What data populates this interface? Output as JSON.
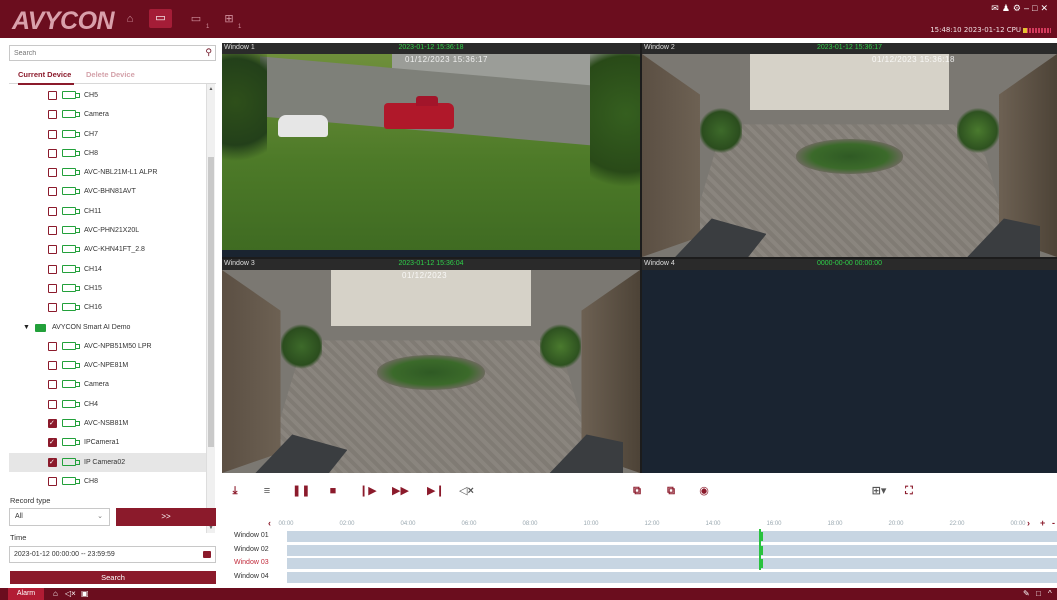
{
  "app": {
    "logo": "AVYCON"
  },
  "topbar": {
    "sub_label_1": "1",
    "sub_label_2": "1",
    "clock_text": "15:48:10 2023-01-12 CPU"
  },
  "sidebar": {
    "search_placeholder": "Search",
    "tabs": {
      "current": "Current Device",
      "delete": "Delete Device"
    },
    "tree": [
      {
        "type": "cam",
        "label": "CH5",
        "checked": false
      },
      {
        "type": "cam",
        "label": "Camera",
        "checked": false
      },
      {
        "type": "cam",
        "label": "CH7",
        "checked": false
      },
      {
        "type": "cam",
        "label": "CH8",
        "checked": false
      },
      {
        "type": "cam",
        "label": "AVC-NBL21M-L1 ALPR",
        "checked": false
      },
      {
        "type": "cam",
        "label": "AVC-BHN81AVT",
        "checked": false
      },
      {
        "type": "cam",
        "label": "CH11",
        "checked": false
      },
      {
        "type": "cam",
        "label": "AVC-PHN21X20L",
        "checked": false
      },
      {
        "type": "cam",
        "label": "AVC-KHN41FT_2.8",
        "checked": false
      },
      {
        "type": "cam",
        "label": "CH14",
        "checked": false
      },
      {
        "type": "cam",
        "label": "CH15",
        "checked": false
      },
      {
        "type": "cam",
        "label": "CH16",
        "checked": false
      },
      {
        "type": "nvr",
        "label": "AVYCON Smart AI Demo"
      },
      {
        "type": "cam",
        "label": "AVC-NPB51M50 LPR",
        "checked": false
      },
      {
        "type": "cam",
        "label": "AVC-NPE81M",
        "checked": false
      },
      {
        "type": "cam",
        "label": "Camera",
        "checked": false
      },
      {
        "type": "cam",
        "label": "CH4",
        "checked": false
      },
      {
        "type": "cam",
        "label": "AVC-NSB81M",
        "checked": true
      },
      {
        "type": "cam",
        "label": "IPCamera1",
        "checked": true
      },
      {
        "type": "cam",
        "label": "IP Camera02",
        "checked": true,
        "selected": true
      },
      {
        "type": "cam",
        "label": "CH8",
        "checked": false
      }
    ],
    "record_type_label": "Record type",
    "record_type_value": "All",
    "go_label": ">>",
    "time_label": "Time",
    "time_value": "2023-01-12 00:00:00 -- 23:59:59",
    "search_button": "Search"
  },
  "windows": [
    {
      "name": "Window 1",
      "timestamp": "2023-01-12 15:36:18",
      "osd": "01/12/2023 15:36:17"
    },
    {
      "name": "Window 2",
      "timestamp": "2023-01-12 15:36:17",
      "osd": "01/12/2023 15:36:18"
    },
    {
      "name": "Window 3",
      "timestamp": "2023-01-12 15:36:04",
      "osd": "01/12/2023"
    },
    {
      "name": "Window 4",
      "timestamp": "0000-00-00 00:00:00",
      "osd": ""
    }
  ],
  "timeline": {
    "hours": [
      "00:00",
      "02:00",
      "04:00",
      "06:00",
      "08:00",
      "10:00",
      "12:00",
      "14:00",
      "16:00",
      "18:00",
      "20:00",
      "22:00",
      "00:00"
    ],
    "rows": [
      {
        "name": "Window 01",
        "active": false
      },
      {
        "name": "Window 02",
        "active": false
      },
      {
        "name": "Window 03",
        "active": true
      },
      {
        "name": "Window 04",
        "active": false
      }
    ]
  },
  "bottombar": {
    "alarm_label": "Alarm"
  },
  "colors": {
    "brand": "#6b0d1e",
    "accent": "#8b1a2b",
    "timestamp_green": "#2fd049",
    "timeline_bar": "#c7d5e2"
  }
}
